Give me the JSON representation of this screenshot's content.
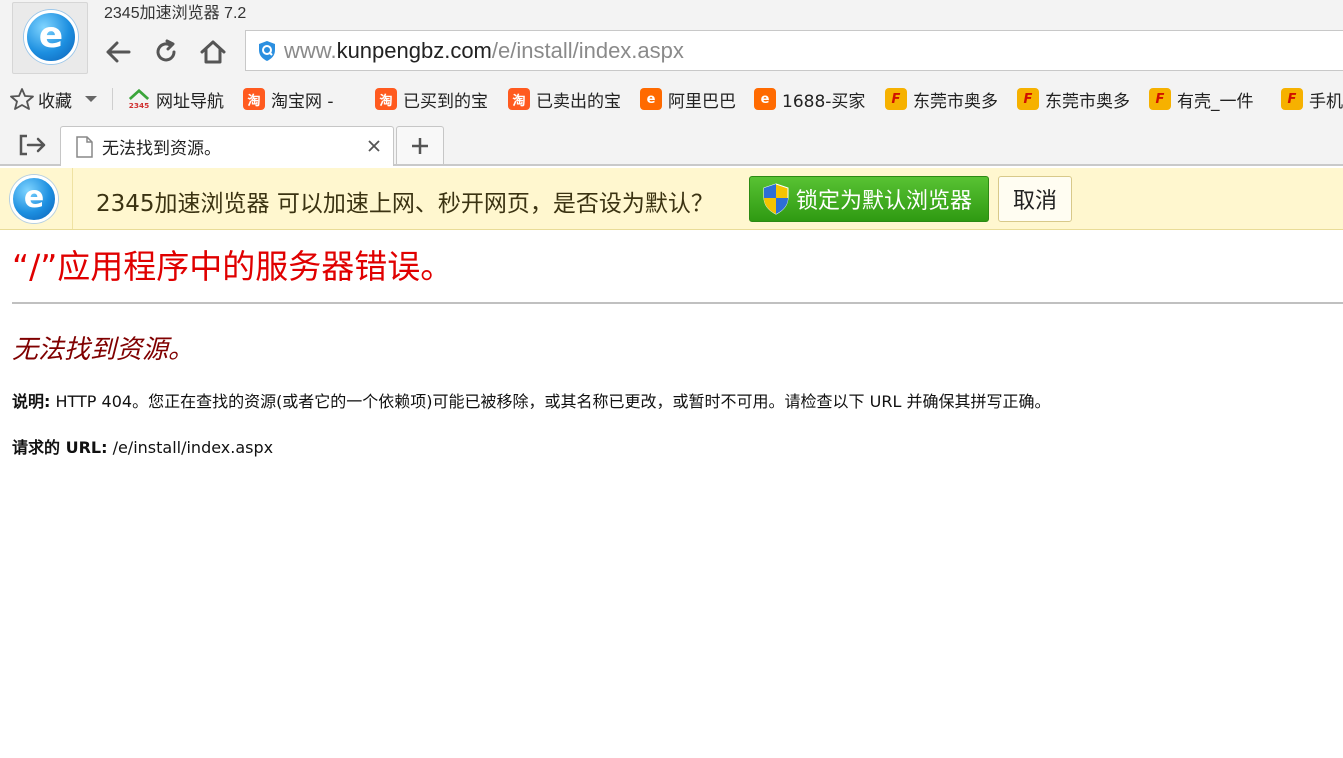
{
  "window": {
    "app_title": "2345加速浏览器 7.2",
    "logo_letter": "e"
  },
  "nav": {
    "back_icon": "arrow-left-icon",
    "reload_icon": "reload-icon",
    "home_icon": "home-icon"
  },
  "address_bar": {
    "url_prefix": "www.",
    "url_domain": "kunpengbz.com",
    "url_path": "/e/install/index.aspx"
  },
  "bookmarks": {
    "favorites_label": "收藏",
    "items": [
      {
        "label": "网址导航",
        "icon": "2345"
      },
      {
        "label": "淘宝网 -",
        "icon": "淘"
      },
      {
        "label": "已买到的宝",
        "icon": "淘"
      },
      {
        "label": "已卖出的宝",
        "icon": "淘"
      },
      {
        "label": "阿里巴巴",
        "icon": "e"
      },
      {
        "label": "1688-买家",
        "icon": "e"
      },
      {
        "label": "东莞市奥多",
        "icon": "F"
      },
      {
        "label": "东莞市奥多",
        "icon": "F"
      },
      {
        "label": "有壳_一件",
        "icon": "F"
      },
      {
        "label": "手机",
        "icon": "F"
      }
    ]
  },
  "tabs": {
    "active_tab_label": "无法找到资源。",
    "new_tab_label": "+"
  },
  "notice": {
    "message": "2345加速浏览器 可以加速上网、秒开网页，是否设为默认？",
    "set_default_label": "锁定为默认浏览器",
    "cancel_label": "取消"
  },
  "page": {
    "error_title": "“/”应用程序中的服务器错误。",
    "error_subtitle": "无法找到资源。",
    "description_label": "说明:",
    "description_text": " HTTP 404。您正在查找的资源(或者它的一个依赖项)可能已被移除，或其名称已更改，或暂时不可用。请检查以下 URL 并确保其拼写正确。",
    "requested_url_label": "请求的 URL:",
    "requested_url_value": " /e/install/index.aspx"
  }
}
